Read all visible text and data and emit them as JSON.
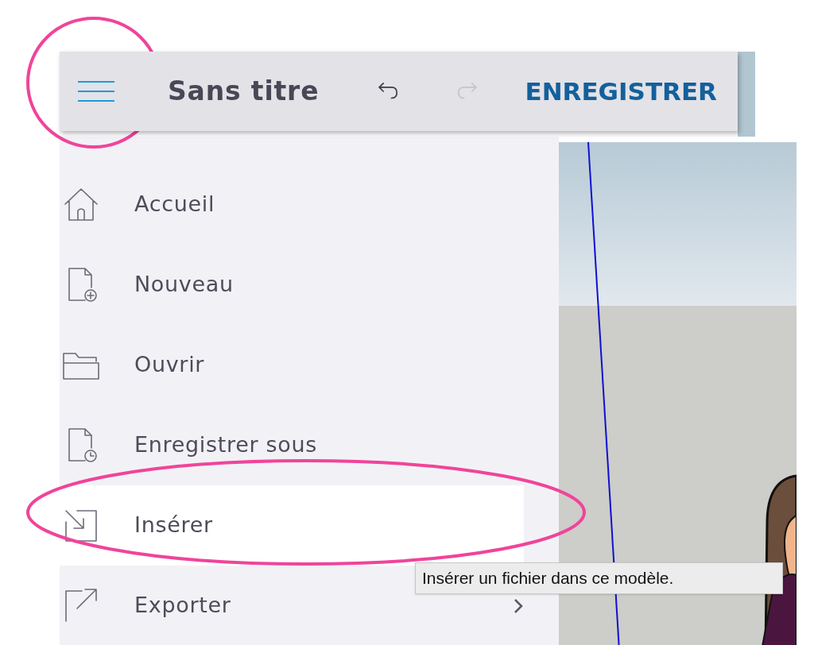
{
  "header": {
    "title": "Sans titre",
    "actions": [
      {
        "kind": "undo",
        "disabled": false
      },
      {
        "kind": "redo",
        "disabled": true
      }
    ],
    "save_label": "ENREGISTRER"
  },
  "menu": {
    "items": [
      {
        "label": "Accueil",
        "selected": false,
        "has_submenu": false
      },
      {
        "label": "Nouveau",
        "selected": false,
        "has_submenu": false
      },
      {
        "label": "Ouvrir",
        "selected": false,
        "has_submenu": false
      },
      {
        "label": "Enregistrer sous",
        "selected": false,
        "has_submenu": false
      },
      {
        "label": "Insérer",
        "selected": true,
        "has_submenu": false
      },
      {
        "label": "Exporter",
        "selected": false,
        "has_submenu": true
      }
    ]
  },
  "tooltip": "Insérer un fichier dans ce modèle."
}
